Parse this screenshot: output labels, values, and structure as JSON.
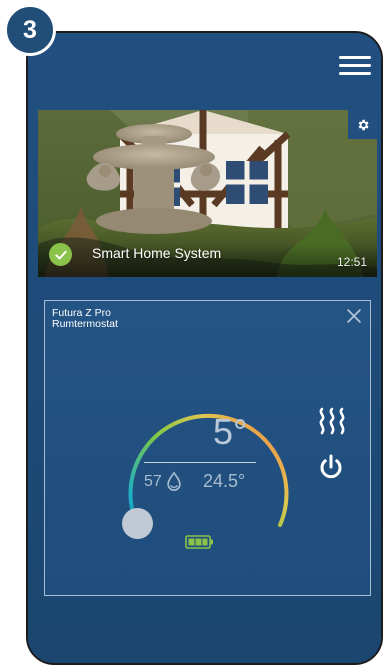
{
  "step": {
    "number": "3"
  },
  "header": {
    "menu_icon": "hamburger-menu-icon",
    "settings_icon": "gear-icon"
  },
  "system": {
    "name": "Smart Home System",
    "time": "12:51",
    "status_icon": "check-circle-icon",
    "status_color": "#8bc34a"
  },
  "device": {
    "name": "Futura Z Pro",
    "type": "Rumtermostat",
    "setpoint": "5°",
    "humidity": "57",
    "current_temperature": "24.5°",
    "humidity_icon": "water-drop-icon",
    "heating_icon": "heat-waves-icon",
    "power_icon": "power-icon",
    "battery_icon": "battery-icon",
    "close_icon": "close-icon"
  },
  "colors": {
    "background": "#1f4e7d",
    "accent": "#8bc34a",
    "card_border": "#a9bdd2"
  }
}
